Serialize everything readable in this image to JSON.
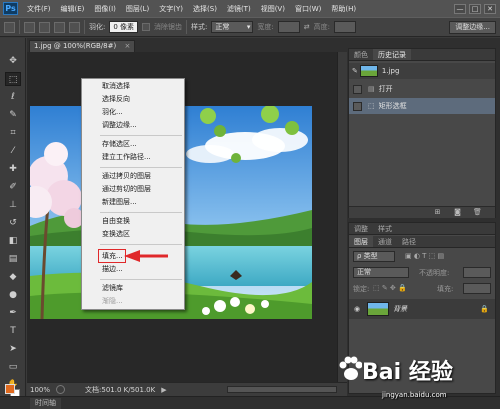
{
  "app": {
    "logo": "Ps",
    "window_buttons": [
      "—",
      "□",
      "✕"
    ]
  },
  "menubar": {
    "items": [
      "文件(F)",
      "编辑(E)",
      "图像(I)",
      "图层(L)",
      "文字(Y)",
      "选择(S)",
      "滤镜(T)",
      "视图(V)",
      "窗口(W)",
      "帮助(H)"
    ]
  },
  "options": {
    "feather_label": "羽化:",
    "feather_value": "0 像素",
    "antialias_label": "消除锯齿",
    "style_label": "样式:",
    "style_value": "正常",
    "width_label": "宽度:",
    "height_label": "高度:",
    "refine_edge": "调整边缘..."
  },
  "document": {
    "tab_title": "1.jpg @ 100%(RGB/8#)",
    "zoom": "100%",
    "doc_info": "文档:501.0 K/501.0K"
  },
  "bottom_tab": {
    "label": "时间轴"
  },
  "context_menu": {
    "items": [
      "取消选择",
      "选择反向",
      "羽化...",
      "调整边缘...",
      "存储选区...",
      "建立工作路径...",
      "通过拷贝的图层",
      "通过剪切的图层",
      "新建图层...",
      "自由变换",
      "变换选区",
      "填充...",
      "描边...",
      "滤镜库",
      "渐隐..."
    ]
  },
  "history_panel": {
    "tabs": [
      "颜色",
      "历史记录"
    ],
    "snapshot": "1.jpg",
    "entries": [
      "打开",
      "矩形选框"
    ]
  },
  "layers_panel": {
    "top_tabs": [
      "调整",
      "样式"
    ],
    "tabs": [
      "图层",
      "通道",
      "路径"
    ],
    "filter_label": "ρ 类型",
    "blend_mode": "正常",
    "opacity_label": "不透明度:",
    "lock_label": "锁定:",
    "fill_label": "填充:",
    "layer_name": "背景"
  },
  "watermark": {
    "text": "Bai 经验",
    "url": "jingyan.baidu.com"
  },
  "colors": {
    "foreground": "#e06a1f",
    "background": "#ffffff",
    "highlight": "#e0282a"
  }
}
